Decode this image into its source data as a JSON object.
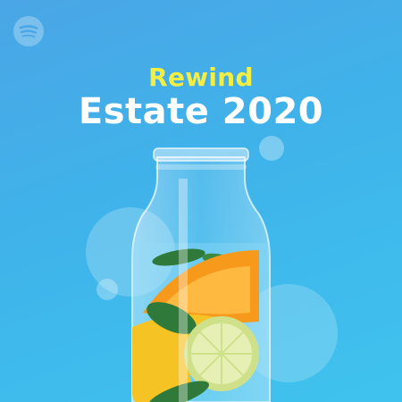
{
  "cover": {
    "kicker": "Rewind",
    "title": "Estate 2020"
  },
  "icons": {
    "brand": "spotify-logo-icon"
  },
  "colors": {
    "background_top": "#4aa6e6",
    "background_bottom": "#3fc3ee",
    "kicker": "#f3ee43",
    "title": "#ffffff",
    "lemon": "#f6c325",
    "orange": "#f79a1c",
    "lime": "#cfe08a",
    "mint": "#2f7a3a"
  }
}
